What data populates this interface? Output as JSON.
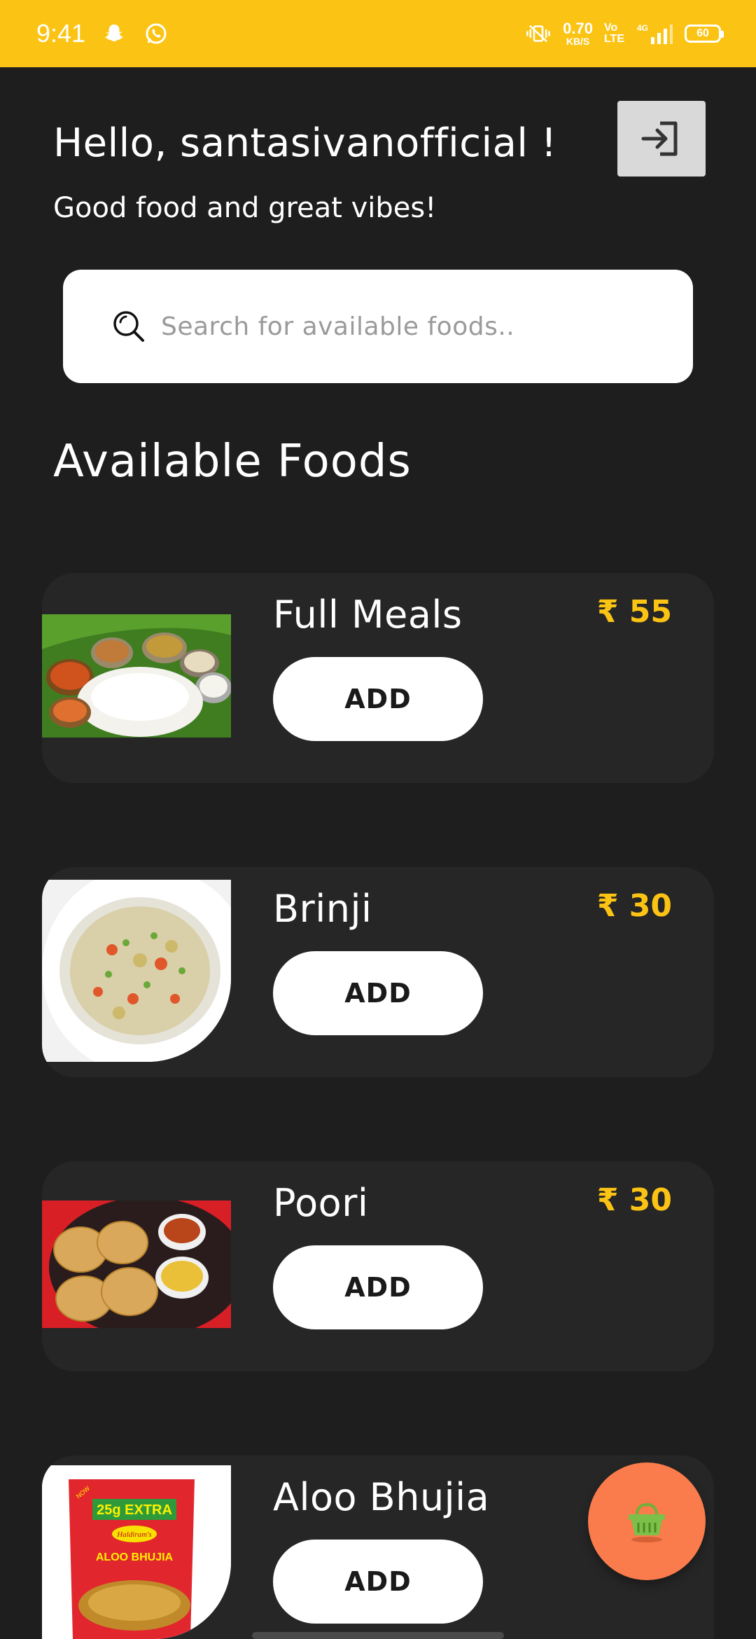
{
  "status_bar": {
    "time": "9:41",
    "speed_value": "0.70",
    "speed_unit": "KB/S",
    "volte_top": "Vo",
    "volte_bottom": "LTE",
    "network": "4G",
    "battery": "60",
    "icons": [
      "snapchat-icon",
      "whatsapp-icon",
      "vibrate-icon",
      "signal-icon"
    ]
  },
  "header": {
    "greeting": "Hello, santasivanofficial !",
    "tagline": "Good food and great vibes!",
    "logout_icon": "login-arrow-icon"
  },
  "search": {
    "placeholder": "Search for available foods..",
    "value": ""
  },
  "section_title": "Available Foods",
  "foods": [
    {
      "name": "Full Meals",
      "price": "₹ 55",
      "button": "ADD",
      "image": "thali-meal"
    },
    {
      "name": "Brinji",
      "price": "₹ 30",
      "button": "ADD",
      "image": "rice-bowl"
    },
    {
      "name": "Poori",
      "price": "₹ 30",
      "button": "ADD",
      "image": "poori-plate"
    },
    {
      "name": "Aloo Bhujia",
      "price": "",
      "button": "ADD",
      "image": "snack-packet"
    }
  ],
  "packet_text": {
    "badge": "25g EXTRA",
    "brand": "Haldiram's",
    "product": "ALOO BHUJIA",
    "now": "NOW"
  },
  "cart": {
    "icon": "basket-icon"
  },
  "colors": {
    "accent": "#fbc414",
    "background": "#1e1e1e",
    "card": "#262626",
    "fab": "#fa7b4b"
  }
}
